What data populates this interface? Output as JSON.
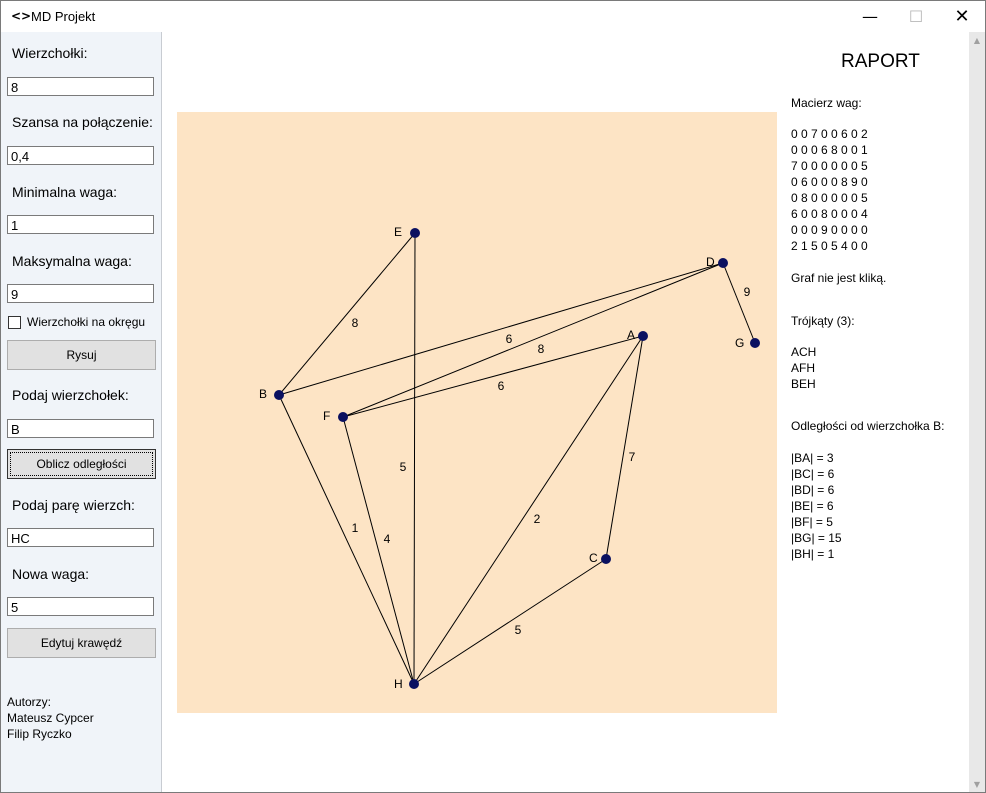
{
  "window": {
    "icon": "<>",
    "title": "MD Projekt",
    "minimize": "—",
    "maximize": "☐",
    "close": "✕"
  },
  "sidebar": {
    "vertices_label": "Wierzchołki:",
    "vertices_value": "8",
    "chance_label": "Szansa na połączenie:",
    "chance_value": "0,4",
    "min_weight_label": "Minimalna waga:",
    "min_weight_value": "1",
    "max_weight_label": "Maksymalna waga:",
    "max_weight_value": "9",
    "circle_checkbox_label": "Wierzchołki na okręgu",
    "circle_checkbox_checked": false,
    "draw_button": "Rysuj",
    "vertex_prompt_label": "Podaj wierzchołek:",
    "vertex_prompt_value": "B",
    "compute_button": "Oblicz odległości",
    "pair_label": "Podaj parę wierzch:",
    "pair_value": "HC",
    "new_weight_label": "Nowa waga:",
    "new_weight_value": "5",
    "edit_button": "Edytuj krawędź",
    "authors_label": "Autorzy:",
    "author1": "Mateusz Cypcer",
    "author2": "Filip Ryczko"
  },
  "graph": {
    "background": "#fde4c5",
    "node_color": "#0a1060",
    "nodes": [
      {
        "id": "A"
      },
      {
        "id": "B"
      },
      {
        "id": "C"
      },
      {
        "id": "D"
      },
      {
        "id": "E"
      },
      {
        "id": "F"
      },
      {
        "id": "G"
      },
      {
        "id": "H"
      }
    ],
    "edges": [
      {
        "a": "B",
        "b": "E",
        "w": "8"
      },
      {
        "a": "E",
        "b": "H",
        "w": "5"
      },
      {
        "a": "B",
        "b": "D",
        "w": "6"
      },
      {
        "a": "F",
        "b": "D",
        "w": "8"
      },
      {
        "a": "F",
        "b": "A",
        "w": "6"
      },
      {
        "a": "D",
        "b": "G",
        "w": "9"
      },
      {
        "a": "B",
        "b": "H",
        "w": "1"
      },
      {
        "a": "F",
        "b": "H",
        "w": "4"
      },
      {
        "a": "A",
        "b": "H",
        "w": "2"
      },
      {
        "a": "A",
        "b": "C",
        "w": "7"
      },
      {
        "a": "C",
        "b": "H",
        "w": "5"
      }
    ]
  },
  "raport": {
    "title": "RAPORT",
    "matrix_label": "Macierz wag:",
    "matrix_rows": [
      "0 0 7 0 0 6 0 2",
      "0 0 0 6 8 0 0 1",
      "7 0 0 0 0 0 0 5",
      "0 6 0 0 0 8 9 0",
      "0 8 0 0 0 0 0 5",
      "6 0 0 8 0 0 0 4",
      "0 0 0 9 0 0 0 0",
      "2 1 5 0 5 4 0 0"
    ],
    "clique_text": "Graf nie jest kliką.",
    "triangles_label": "Trójkąty (3):",
    "triangles": [
      "ACH",
      "AFH",
      "BEH"
    ],
    "distances_label": "Odległości od wierzchołka B:",
    "distances": [
      "|BA| = 3",
      "|BC| = 6",
      "|BD| = 6",
      "|BE| = 6",
      "|BF| = 5",
      "|BG| = 15",
      "|BH| = 1"
    ]
  }
}
